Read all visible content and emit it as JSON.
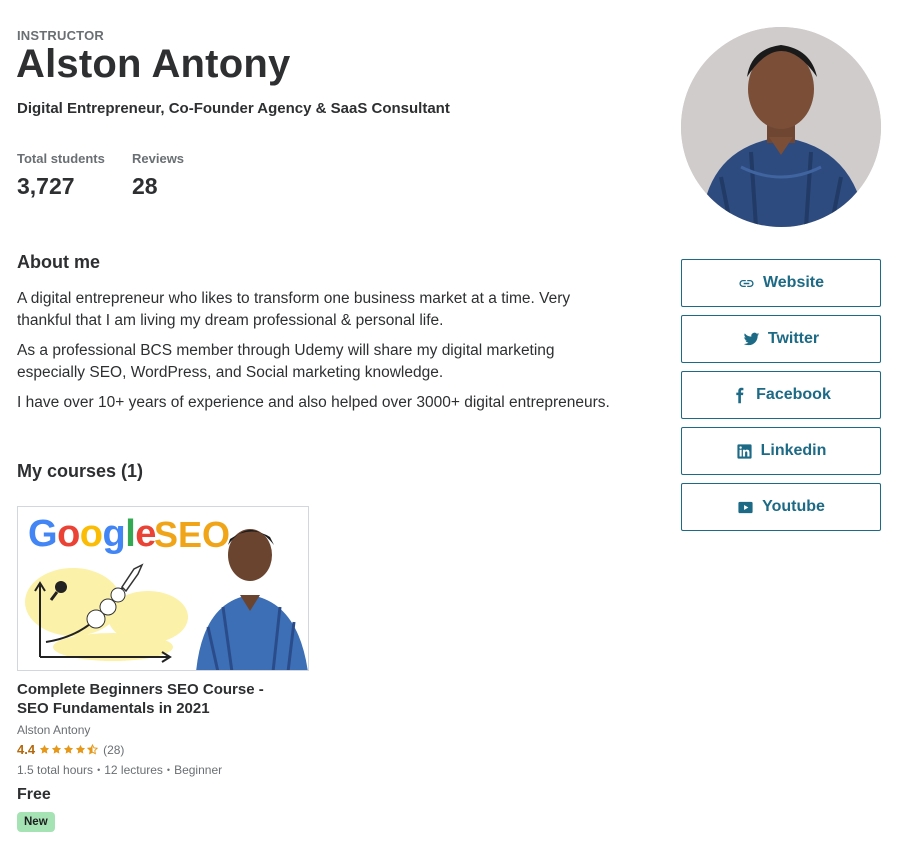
{
  "header": {
    "label": "INSTRUCTOR",
    "name": "Alston Antony",
    "headline": "Digital Entrepreneur, Co-Founder Agency & SaaS Consultant"
  },
  "stats": [
    {
      "label": "Total students",
      "value": "3,727"
    },
    {
      "label": "Reviews",
      "value": "28"
    }
  ],
  "about": {
    "title": "About me",
    "paragraphs": [
      "A digital entrepreneur who likes to transform one business market at a time. Very thankful that I am living my dream professional & personal life.",
      "As a professional BCS member through Udemy will share my digital marketing especially SEO, WordPress, and Social marketing knowledge.",
      "I have over 10+ years of experience and also helped over 3000+ digital entrepreneurs."
    ]
  },
  "courses": {
    "title": "My courses (1)",
    "items": [
      {
        "thumb_text_google": "Google",
        "thumb_text_seo": "SEO",
        "title": "Complete Beginners SEO Course - SEO Fundamentals in 2021",
        "author": "Alston Antony",
        "rating": "4.4",
        "stars_filled": 4.5,
        "rating_count": "(28)",
        "hours": "1.5 total hours",
        "lectures": "12 lectures",
        "level": "Beginner",
        "price": "Free",
        "badge": "New"
      }
    ]
  },
  "social": [
    {
      "label": "Website",
      "icon": "link-icon"
    },
    {
      "label": "Twitter",
      "icon": "twitter-icon"
    },
    {
      "label": "Facebook",
      "icon": "facebook-icon"
    },
    {
      "label": "Linkedin",
      "icon": "linkedin-icon"
    },
    {
      "label": "Youtube",
      "icon": "youtube-icon"
    }
  ],
  "colors": {
    "accent": "#1c6a85",
    "rating": "#b4690e",
    "badge": "#a6e3b4",
    "text": "#2d2f31",
    "muted": "#6a6f73"
  }
}
